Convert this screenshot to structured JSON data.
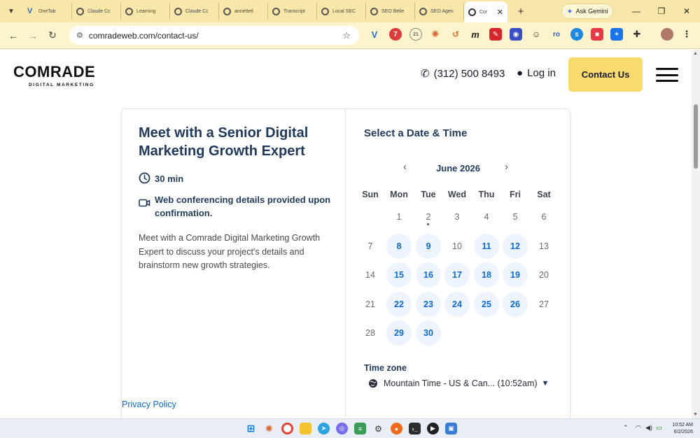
{
  "browser": {
    "tabs": [
      {
        "label": "OneTab",
        "favicon": "v-logo-icon"
      },
      {
        "label": "Claude Cc",
        "favicon": "globe-icon"
      },
      {
        "label": "Learning",
        "favicon": "globe-icon"
      },
      {
        "label": "Claude Cc",
        "favicon": "globe-icon"
      },
      {
        "label": "annettetl",
        "favicon": "globe-icon"
      },
      {
        "label": "Transcript",
        "favicon": "globe-icon"
      },
      {
        "label": "Local SEC",
        "favicon": "globe-icon"
      },
      {
        "label": "SEO Belie",
        "favicon": "globe-icon"
      },
      {
        "label": "SEO Agen",
        "favicon": "globe-icon"
      }
    ],
    "active_tab": {
      "label": "Cor",
      "favicon": "loading-icon"
    },
    "gemini_label": "Ask Gemini",
    "url": "comradeweb.com/contact-us/",
    "extension_badge_count": "7",
    "extension_badge_2": "21"
  },
  "site": {
    "logo_word": "COMRADE",
    "logo_sub": "DIGITAL MARKETING",
    "phone": "(312) 500 8493",
    "login": "Log in",
    "contact_button": "Contact Us"
  },
  "event": {
    "title": "Meet with a Senior Digital Marketing Growth Expert",
    "duration": "30 min",
    "conferencing": "Web conferencing details provided upon confirmation.",
    "description": "Meet with a Comrade Digital Marketing Growth Expert to discuss your project's details and brainstorm new growth strategies.",
    "privacy": "Privacy Policy"
  },
  "calendar": {
    "heading": "Select a Date & Time",
    "month": "June 2026",
    "weekdays": [
      "Sun",
      "Mon",
      "Tue",
      "Wed",
      "Thu",
      "Fri",
      "Sat"
    ],
    "weeks": [
      [
        null,
        "1",
        "2",
        "3",
        "4",
        "5",
        "6"
      ],
      [
        "7",
        "8",
        "9",
        "10",
        "11",
        "12",
        "13"
      ],
      [
        "14",
        "15",
        "16",
        "17",
        "18",
        "19",
        "20"
      ],
      [
        "21",
        "22",
        "23",
        "24",
        "25",
        "26",
        "27"
      ],
      [
        "28",
        "29",
        "30",
        null,
        null,
        null,
        null
      ]
    ],
    "available_days": [
      "8",
      "9",
      "11",
      "12",
      "15",
      "16",
      "17",
      "18",
      "19",
      "22",
      "23",
      "24",
      "25",
      "26",
      "29",
      "30"
    ],
    "today": "2",
    "timezone_label": "Time zone",
    "timezone_value": "Mountain Time - US & Can... (10:52am)"
  },
  "taskbar": {
    "time": "10:52 AM",
    "date": "6/2/2026"
  },
  "colors": {
    "tab_strip": "#f9e7a9",
    "accent_button": "#f9db6d",
    "link_blue": "#0a6ad1",
    "heading_navy": "#1f3a5c",
    "available_day_bg": "#eef4fd"
  }
}
